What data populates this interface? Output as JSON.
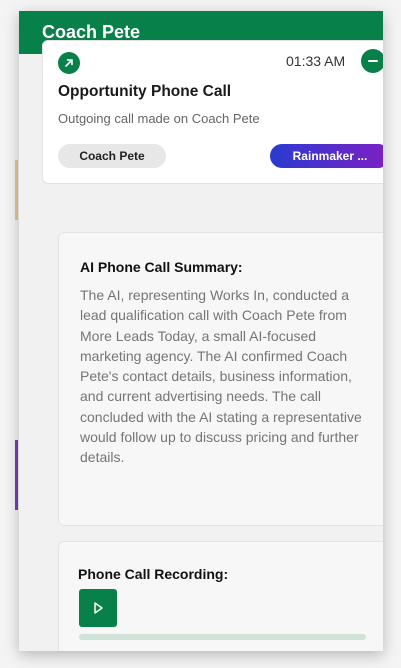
{
  "header": {
    "title": "Coach Pete"
  },
  "card": {
    "time": "01:33 AM",
    "title": "Opportunity Phone Call",
    "subtitle": "Outgoing call made on Coach Pete",
    "chip_contact": "Coach Pete",
    "chip_agent": "Rainmaker ...",
    "icons": {
      "left": "arrow-up-right-icon",
      "right": "collapse-minus-icon"
    }
  },
  "summary": {
    "title": "AI Phone Call Summary:",
    "text": "The AI, representing Works In, conducted a lead qualification call with Coach Pete from More Leads Today, a small AI-focused marketing agency. The AI confirmed Coach Pete's contact details, business information, and current advertising needs. The call concluded with the AI stating a representative would follow up to discuss pricing and further details."
  },
  "recording": {
    "title": "Phone Call Recording:",
    "play_icon": "play-icon",
    "progress": 0
  },
  "colors": {
    "brand": "#08804a",
    "chip_gradient_start": "#2a3bd0",
    "chip_gradient_end": "#7e1fc4"
  }
}
